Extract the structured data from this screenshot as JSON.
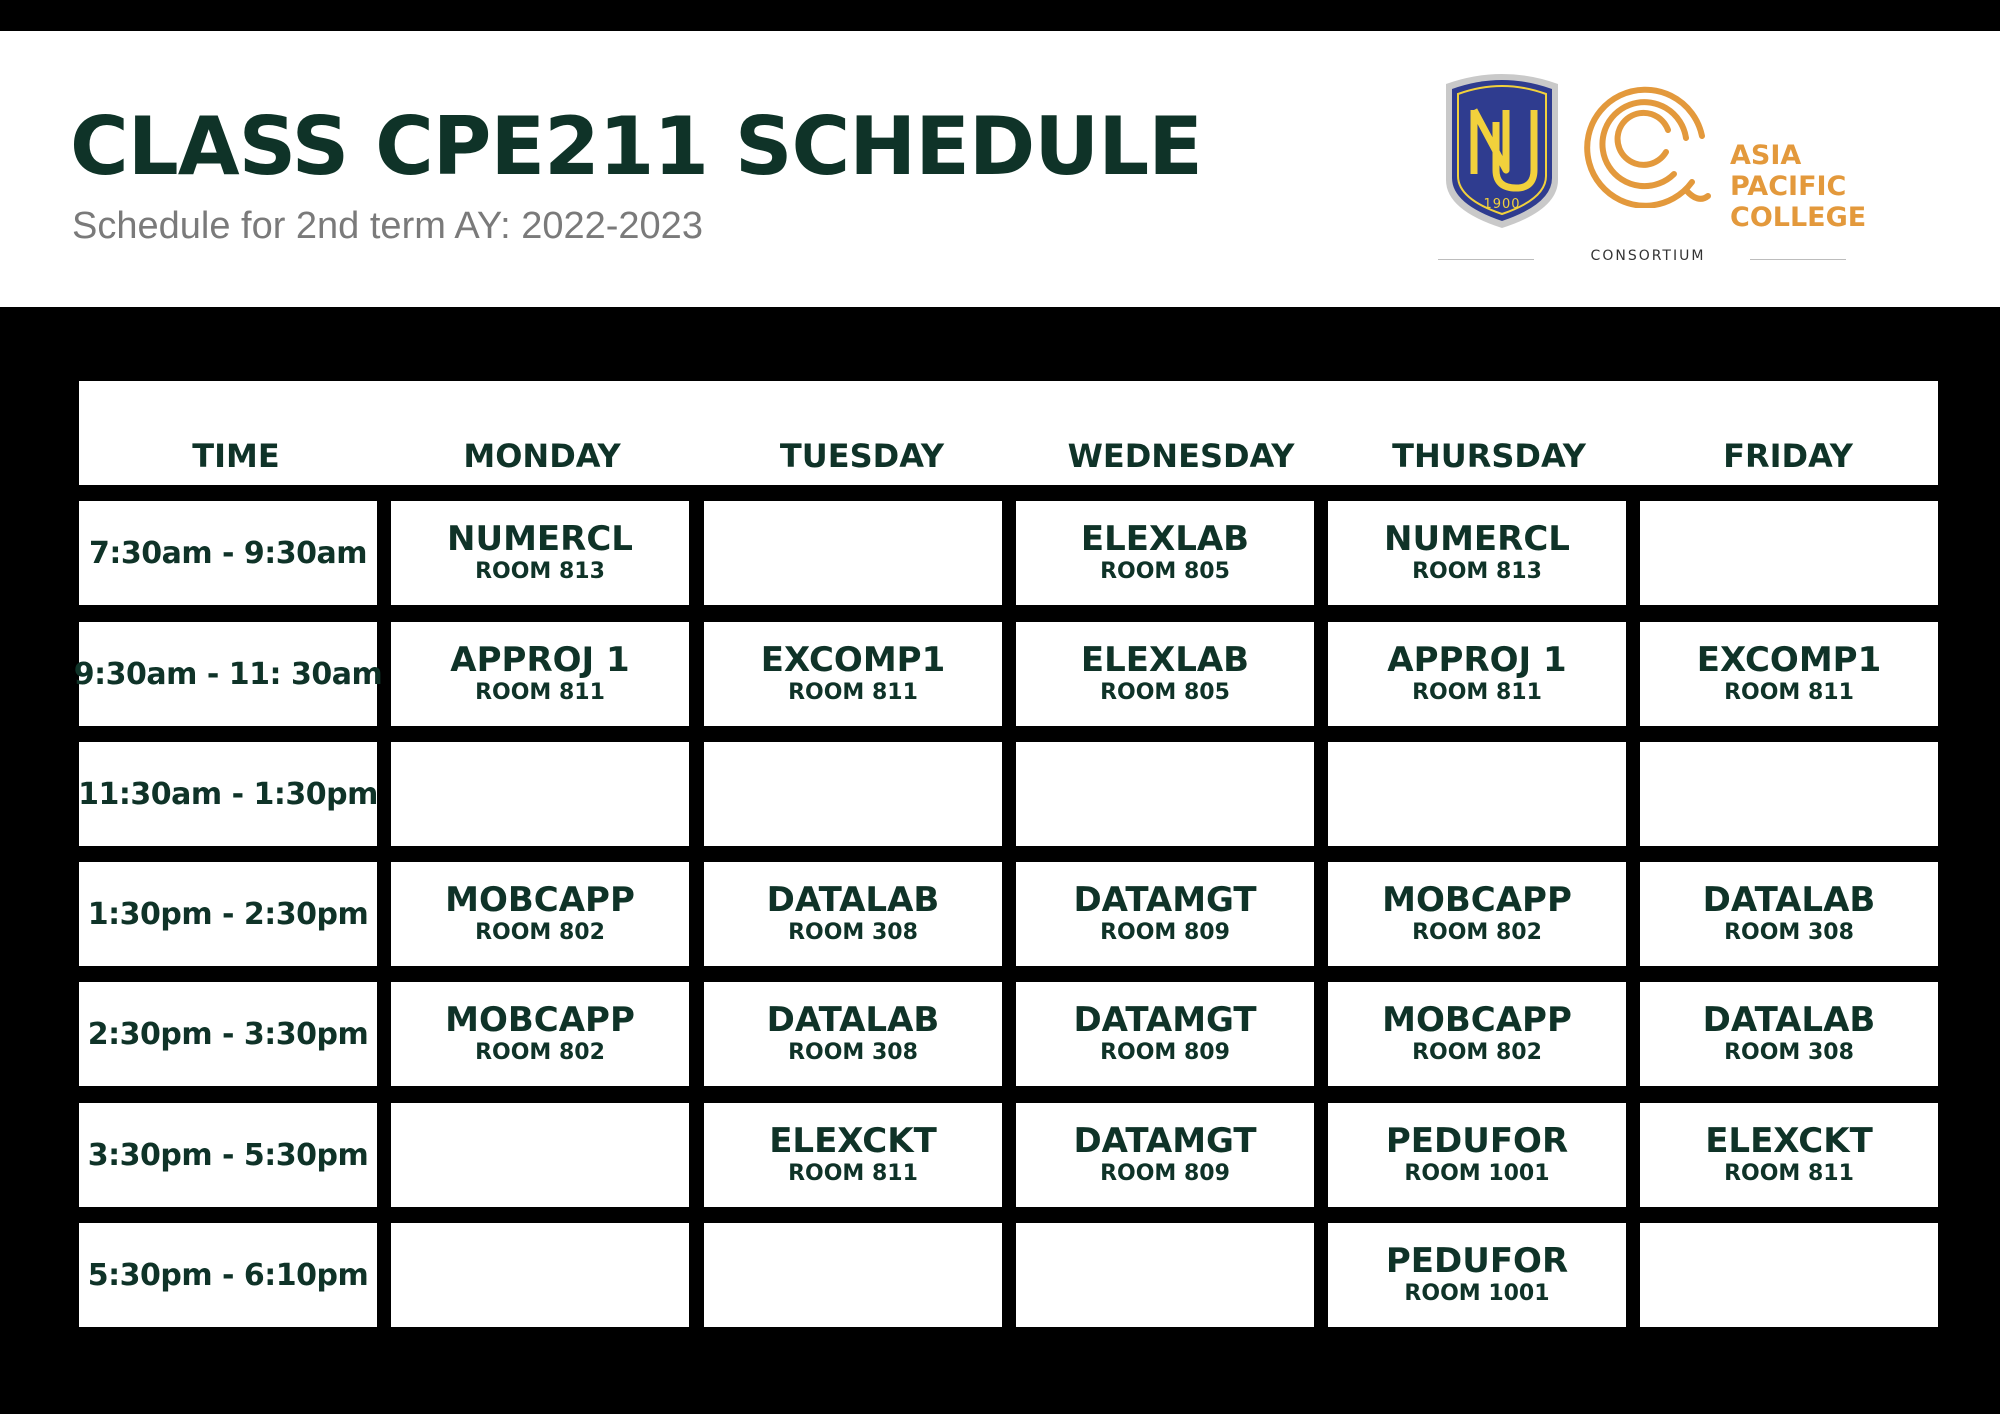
{
  "header": {
    "title": "CLASS CPE211 SCHEDULE",
    "subtitle": "Schedule for 2nd term AY: 2022-2023",
    "nu_logo": {
      "year": "1900",
      "colors": {
        "shield": "#2f3c8f",
        "gold": "#f2d13c"
      }
    },
    "apc_logo": {
      "lines": [
        "ASIA",
        "PACIFIC",
        "COLLEGE"
      ],
      "color": "#e3993c"
    },
    "consortium": "CONSORTIUM"
  },
  "colors": {
    "text": "#0f3328",
    "background": "#000000",
    "cell": "#ffffff",
    "subtitle": "#7a7a7a"
  },
  "schedule": {
    "time_header": "TIME",
    "days": [
      "MONDAY",
      "TUESDAY",
      "WEDNESDAY",
      "THURSDAY",
      "FRIDAY"
    ],
    "rows": [
      {
        "time": "7:30am - 9:30am",
        "cells": [
          {
            "course": "NUMERCL",
            "room": "ROOM 813"
          },
          null,
          {
            "course": "ELEXLAB",
            "room": "ROOM 805"
          },
          {
            "course": "NUMERCL",
            "room": "ROOM 813"
          },
          null
        ]
      },
      {
        "time": "9:30am - 11: 30am",
        "cells": [
          {
            "course": "APPROJ 1",
            "room": "ROOM 811"
          },
          {
            "course": "EXCOMP1",
            "room": "ROOM 811"
          },
          {
            "course": "ELEXLAB",
            "room": "ROOM 805"
          },
          {
            "course": "APPROJ 1",
            "room": "ROOM 811"
          },
          {
            "course": "EXCOMP1",
            "room": "ROOM 811"
          }
        ]
      },
      {
        "time": "11:30am - 1:30pm",
        "cells": [
          null,
          null,
          null,
          null,
          null
        ]
      },
      {
        "time": "1:30pm - 2:30pm",
        "cells": [
          {
            "course": "MOBCAPP",
            "room": "ROOM 802"
          },
          {
            "course": "DATALAB",
            "room": "ROOM 308"
          },
          {
            "course": "DATAMGT",
            "room": "ROOM 809"
          },
          {
            "course": "MOBCAPP",
            "room": "ROOM 802"
          },
          {
            "course": "DATALAB",
            "room": "ROOM 308"
          }
        ]
      },
      {
        "time": "2:30pm - 3:30pm",
        "cells": [
          {
            "course": "MOBCAPP",
            "room": "ROOM 802"
          },
          {
            "course": "DATALAB",
            "room": "ROOM 308"
          },
          {
            "course": "DATAMGT",
            "room": "ROOM 809"
          },
          {
            "course": "MOBCAPP",
            "room": "ROOM 802"
          },
          {
            "course": "DATALAB",
            "room": "ROOM 308"
          }
        ]
      },
      {
        "time": "3:30pm - 5:30pm",
        "cells": [
          null,
          {
            "course": "ELEXCKT",
            "room": "ROOM 811"
          },
          {
            "course": "DATAMGT",
            "room": "ROOM 809"
          },
          {
            "course": "PEDUFOR",
            "room": "ROOM 1001"
          },
          {
            "course": "ELEXCKT",
            "room": "ROOM 811"
          }
        ]
      },
      {
        "time": "5:30pm - 6:10pm",
        "cells": [
          null,
          null,
          null,
          {
            "course": "PEDUFOR",
            "room": "ROOM 1001"
          },
          null
        ]
      }
    ]
  }
}
